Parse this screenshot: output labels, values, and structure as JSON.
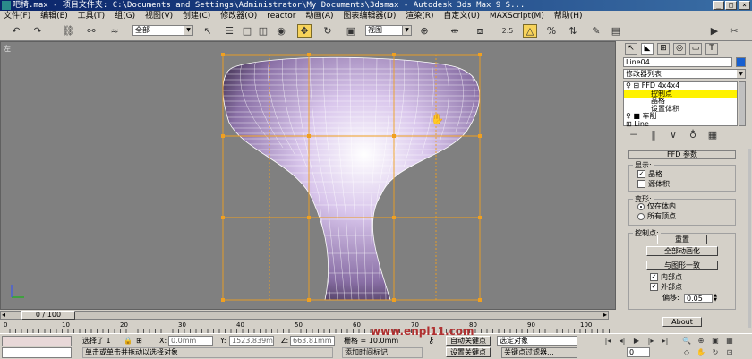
{
  "window": {
    "title": "吧椅.max   - 项目文件夹: C:\\Documents and Settings\\Administrator\\My Documents\\3dsmax   - Autodesk 3ds Max 9 S..."
  },
  "menu": [
    "文件(F)",
    "编辑(E)",
    "工具(T)",
    "组(G)",
    "视图(V)",
    "创建(C)",
    "修改器(O)",
    "reactor",
    "动画(A)",
    "图表编辑器(D)",
    "渲染(R)",
    "自定义(U)",
    "MAXScript(M)",
    "帮助(H)"
  ],
  "toolbar": {
    "selection_filter": "全部",
    "reference_coord": "视图",
    "snap_value": "2.5"
  },
  "viewport": {
    "label": "左"
  },
  "panel": {
    "object_name": "Line04",
    "modifier_list": "修改器列表",
    "stack": [
      "FFD 4x4x4",
      "控制点",
      "晶格",
      "设置体积",
      "车削",
      "Line"
    ],
    "rollout_title": "FFD 参数",
    "display_group": "显示:",
    "lattice_label": "晶格",
    "source_volume_label": "源体积",
    "deform_group": "变形:",
    "only_in_volume": "仅在体内",
    "all_vertices": "所有顶点",
    "control_points_group": "控制点:",
    "reset_button": "重置",
    "animate_all_button": "全部动画化",
    "conform_button": "与图形一致",
    "inside_points": "内部点",
    "outside_points": "外部点",
    "offset_label": "偏移:",
    "offset_value": "0.05",
    "about_button": "About"
  },
  "timeline": {
    "frame_display": "0 / 100",
    "ticks": [
      "0",
      "10",
      "20",
      "30",
      "40",
      "50",
      "60",
      "70",
      "80",
      "90",
      "100"
    ]
  },
  "status": {
    "selection_info": "选择了 1",
    "x_label": "X:",
    "x_value": "0.0mm",
    "y_label": "Y:",
    "y_value": "1523.839m",
    "z_label": "Z:",
    "z_value": "663.81mm",
    "grid_label": "栅格 = 10.0mm",
    "watermark": "www.enpl11.com",
    "prompt_text": "单击或单击并拖动以选择对象",
    "add_time_tag": "添加时间标记",
    "auto_key": "自动关键点",
    "set_key": "设置关键点",
    "selected_object": "选定对象",
    "key_filters": "关键点过滤器...",
    "frame_number": "0"
  }
}
